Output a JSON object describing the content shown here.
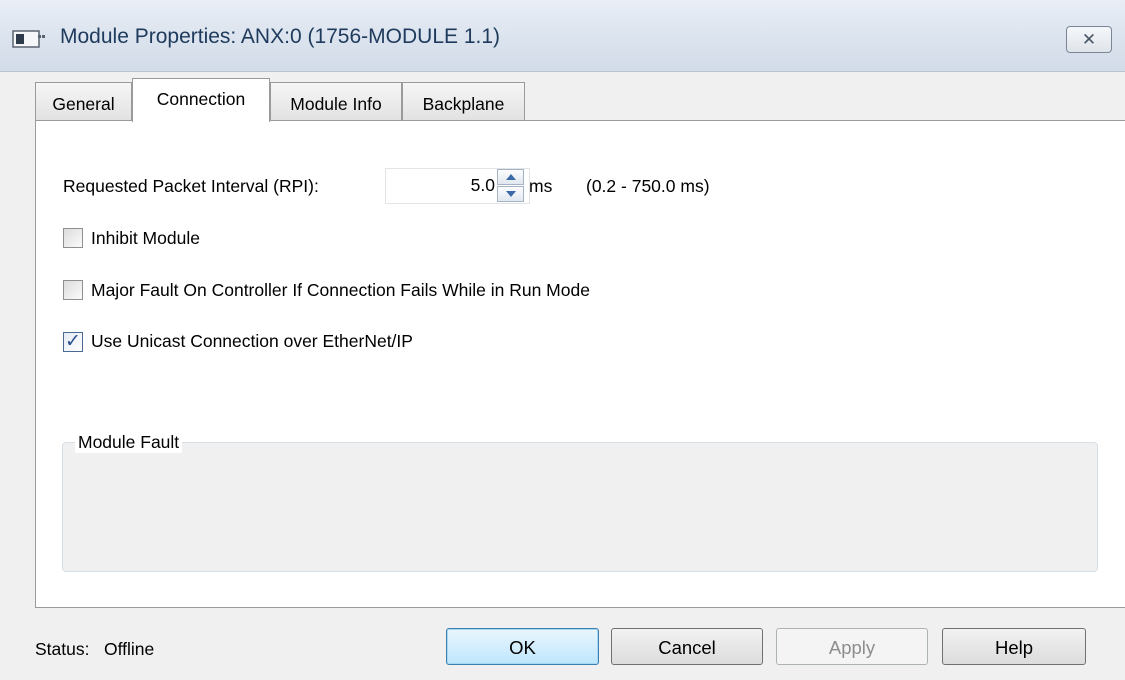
{
  "window": {
    "title": "Module Properties: ANX:0 (1756-MODULE 1.1)",
    "close_symbol": "✕"
  },
  "tabs": [
    {
      "label": "General",
      "active": false
    },
    {
      "label": "Connection",
      "active": true
    },
    {
      "label": "Module Info",
      "active": false
    },
    {
      "label": "Backplane",
      "active": false
    }
  ],
  "connection": {
    "rpi_label": "Requested Packet Interval (RPI):",
    "rpi_value": "5.0",
    "rpi_unit": "ms",
    "rpi_range": "(0.2 - 750.0 ms)",
    "options": [
      {
        "label": "Inhibit Module",
        "checked": false
      },
      {
        "label": "Major Fault On Controller If Connection Fails While in Run Mode",
        "checked": false
      },
      {
        "label": "Use Unicast Connection over EtherNet/IP",
        "checked": true
      }
    ],
    "fault_group_title": "Module Fault"
  },
  "footer": {
    "status_label": "Status:",
    "status_value": "Offline",
    "buttons": {
      "ok": "OK",
      "cancel": "Cancel",
      "apply": "Apply",
      "help": "Help"
    }
  },
  "icons": {
    "window_icon": "module-window-icon",
    "close_icon": "close-icon",
    "spin_up": "spin-up-icon",
    "spin_down": "spin-down-icon",
    "check": "checkmark-icon"
  },
  "colors": {
    "title_text": "#1e3a5c",
    "ok_button": "#bee6fd",
    "check_mark": "#2b4f8e"
  }
}
